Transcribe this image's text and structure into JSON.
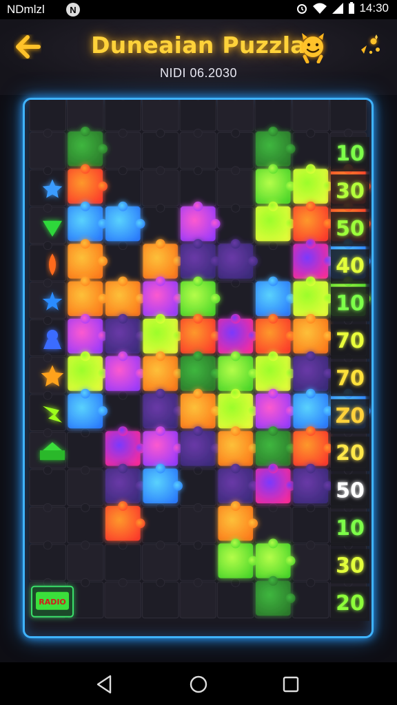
{
  "status_bar": {
    "carrier": "NDmlzl",
    "notification_badge": "N",
    "time": "14:30"
  },
  "header": {
    "title": "Duneaian Puzzla",
    "subtitle": "NIDI 06.2030",
    "back_icon": "arrow-left-icon",
    "mascot_icon": "smiley-mascot-icon",
    "sparkle_icon": "sparkle-icon"
  },
  "board": {
    "border_color": "#3fb3ff",
    "row_icons": [
      "",
      "star-icon",
      "green-triangle-icon",
      "orange-flame-icon",
      "blue-star-icon",
      "blue-pawn-icon",
      "orange-star-icon",
      "green-lizard-icon",
      "green-house-icon",
      "",
      "",
      "",
      "green-badge-icon"
    ],
    "badge_text": "RADIO",
    "scores": [
      "10",
      "30",
      "50",
      "40",
      "10",
      "70",
      "70",
      "Z0",
      "20",
      "50",
      "10",
      "30",
      "20"
    ],
    "score_colors": [
      "#7dff4a",
      "#b4ff3a",
      "#9dff3a",
      "#e2ff3a",
      "#7dff4a",
      "#e9ff3a",
      "#ffe13a",
      "#ffd23a",
      "#ffe74a",
      "#ffffff",
      "#7dff4a",
      "#e2ff3a",
      "#8dff3a"
    ]
  },
  "nav": {
    "back": "nav-back-icon",
    "home": "nav-home-icon",
    "recent": "nav-recent-icon"
  }
}
